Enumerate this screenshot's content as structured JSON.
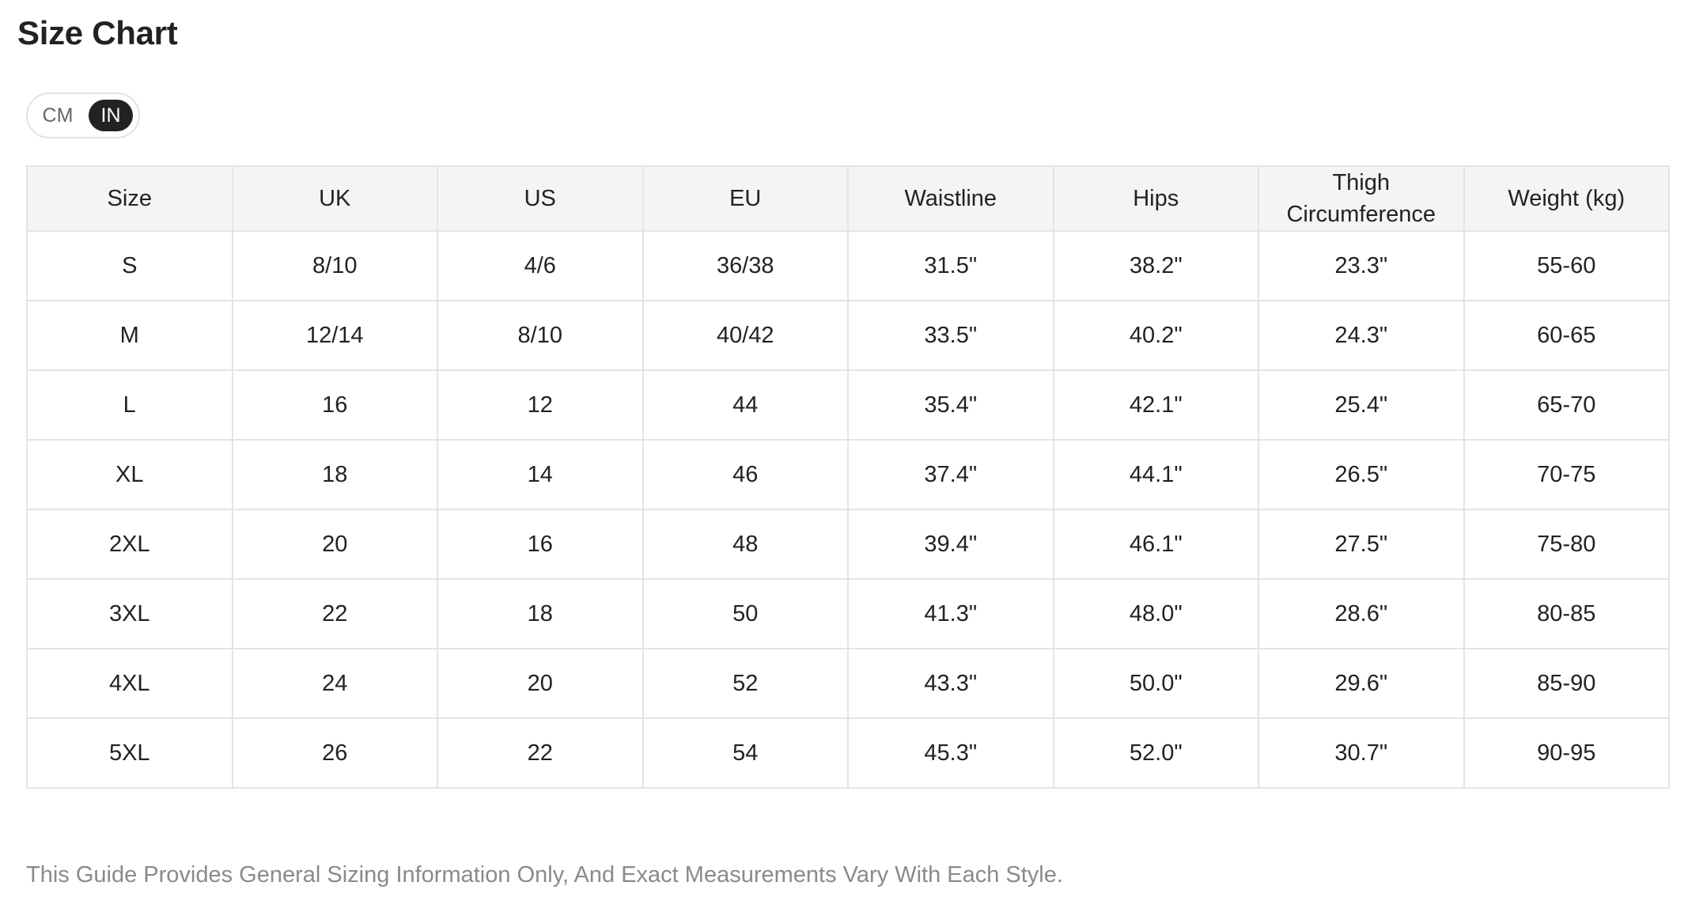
{
  "title": "Size Chart",
  "unit_toggle": {
    "options": [
      "CM",
      "IN"
    ],
    "selected": "IN"
  },
  "table": {
    "headers": [
      "Size",
      "UK",
      "US",
      "EU",
      "Waistline",
      "Hips",
      "Thigh Circumference",
      "Weight (kg)"
    ],
    "rows": [
      [
        "S",
        "8/10",
        "4/6",
        "36/38",
        "31.5\"",
        "38.2\"",
        "23.3\"",
        "55-60"
      ],
      [
        "M",
        "12/14",
        "8/10",
        "40/42",
        "33.5\"",
        "40.2\"",
        "24.3\"",
        "60-65"
      ],
      [
        "L",
        "16",
        "12",
        "44",
        "35.4\"",
        "42.1\"",
        "25.4\"",
        "65-70"
      ],
      [
        "XL",
        "18",
        "14",
        "46",
        "37.4\"",
        "44.1\"",
        "26.5\"",
        "70-75"
      ],
      [
        "2XL",
        "20",
        "16",
        "48",
        "39.4\"",
        "46.1\"",
        "27.5\"",
        "75-80"
      ],
      [
        "3XL",
        "22",
        "18",
        "50",
        "41.3\"",
        "48.0\"",
        "28.6\"",
        "80-85"
      ],
      [
        "4XL",
        "24",
        "20",
        "52",
        "43.3\"",
        "50.0\"",
        "29.6\"",
        "85-90"
      ],
      [
        "5XL",
        "26",
        "22",
        "54",
        "45.3\"",
        "52.0\"",
        "30.7\"",
        "90-95"
      ]
    ]
  },
  "footnote": "This Guide Provides General Sizing Information Only, And Exact Measurements Vary With Each Style.",
  "colors": {
    "text": "#222222",
    "header_bg": "#f4f4f4",
    "border": "#e4e4e4",
    "toggle_active_bg": "#222222",
    "footnote": "#8a8a8a"
  }
}
